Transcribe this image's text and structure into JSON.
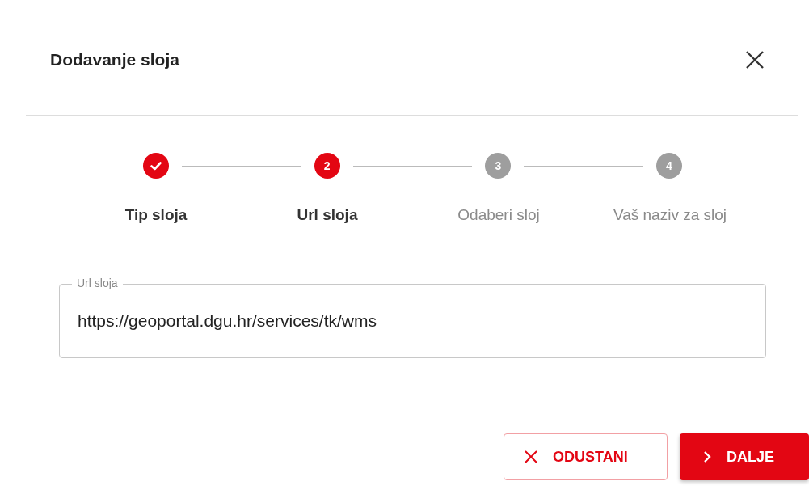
{
  "dialog": {
    "title": "Dodavanje sloja"
  },
  "steps": [
    {
      "label": "Tip sloja",
      "kind": "done"
    },
    {
      "number": "2",
      "label": "Url sloja",
      "kind": "active"
    },
    {
      "number": "3",
      "label": "Odaberi sloj",
      "kind": "pending"
    },
    {
      "number": "4",
      "label": "Vaš naziv za sloj",
      "kind": "pending"
    }
  ],
  "field": {
    "label": "Url sloja",
    "value": "https://geoportal.dgu.hr/services/tk/wms"
  },
  "buttons": [
    {
      "label": "ODUSTANI",
      "kind": "cancel"
    },
    {
      "label": "DALJE",
      "kind": "next"
    }
  ]
}
